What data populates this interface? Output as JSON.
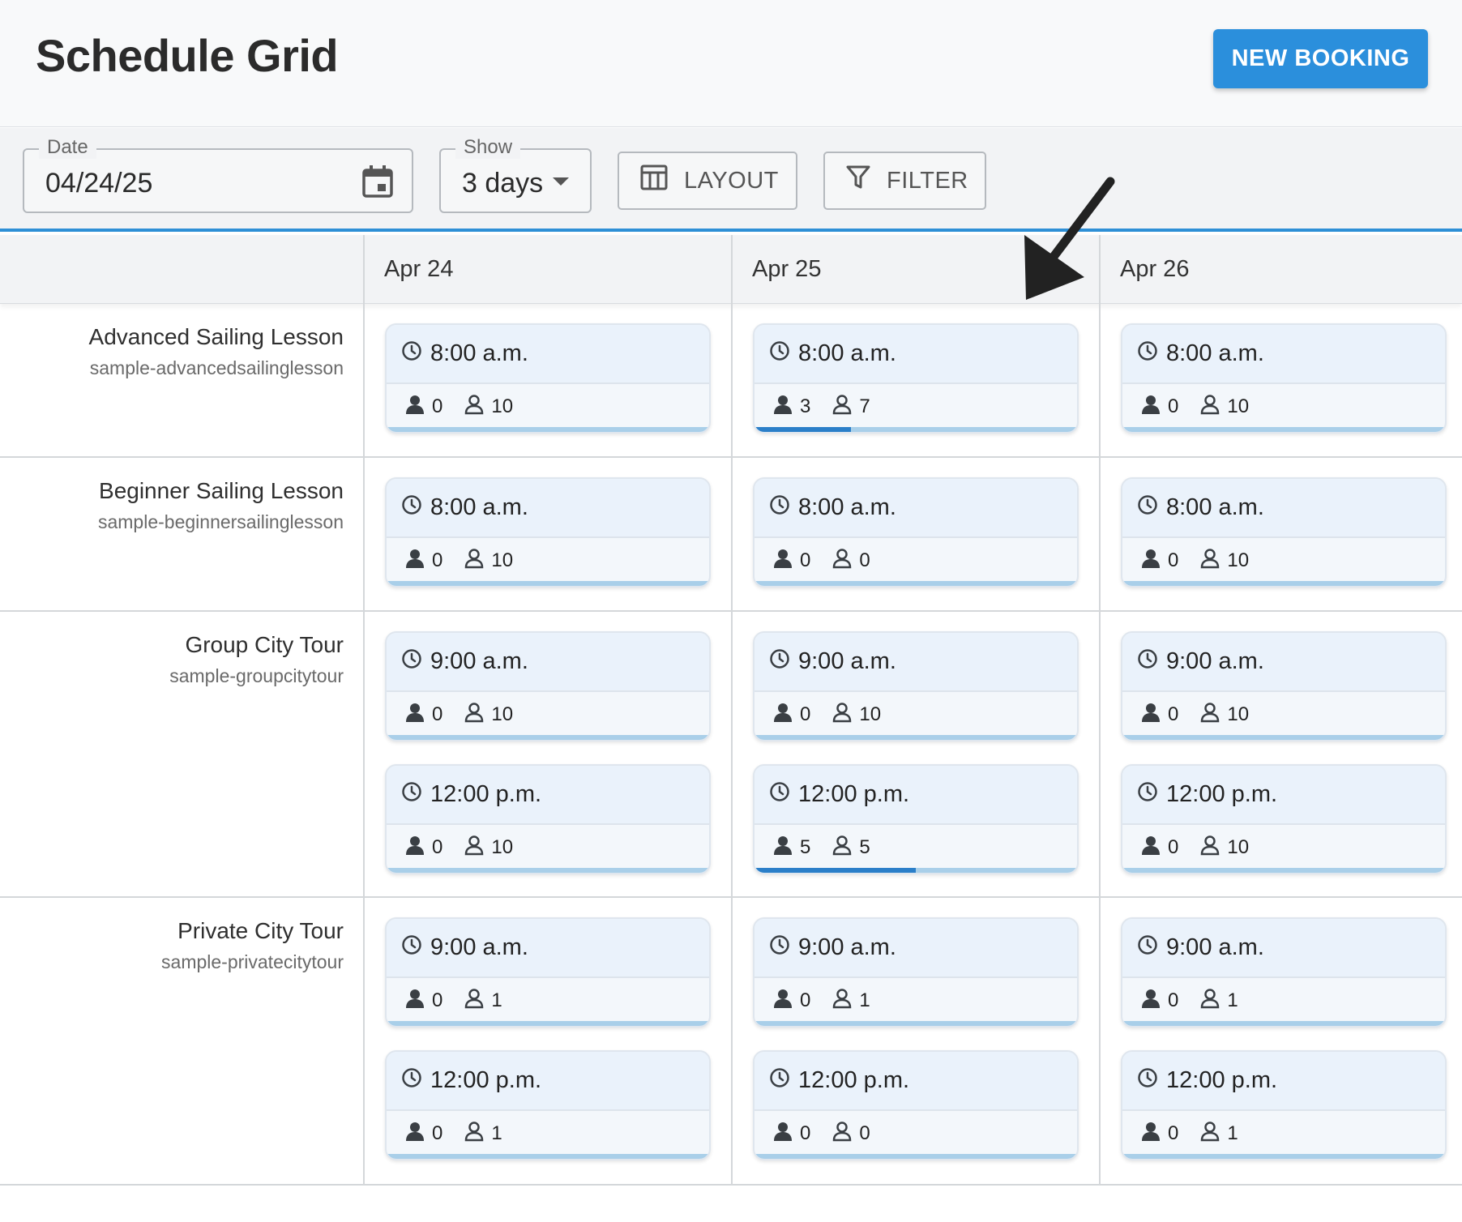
{
  "header": {
    "title": "Schedule Grid",
    "new_booking_label": "NEW BOOKING"
  },
  "toolbar": {
    "date_label": "Date",
    "date_value": "04/24/25",
    "show_label": "Show",
    "show_value": "3 days",
    "layout_label": "LAYOUT",
    "filter_label": "FILTER"
  },
  "days": [
    "Apr 24",
    "Apr 25",
    "Apr 26"
  ],
  "products": [
    {
      "name": "Advanced Sailing Lesson",
      "slug": "sample-advancedsailinglesson"
    },
    {
      "name": "Beginner Sailing Lesson",
      "slug": "sample-beginnersailinglesson"
    },
    {
      "name": "Group City Tour",
      "slug": "sample-groupcitytour"
    },
    {
      "name": "Private City Tour",
      "slug": "sample-privatecitytour"
    }
  ],
  "slots": [
    [
      [
        {
          "time": "8:00 a.m.",
          "booked": "0",
          "available": "10",
          "fill": 0
        }
      ],
      [
        {
          "time": "8:00 a.m.",
          "booked": "3",
          "available": "7",
          "fill": 0.3
        }
      ],
      [
        {
          "time": "8:00 a.m.",
          "booked": "0",
          "available": "10",
          "fill": 0
        }
      ]
    ],
    [
      [
        {
          "time": "8:00 a.m.",
          "booked": "0",
          "available": "10",
          "fill": 0
        }
      ],
      [
        {
          "time": "8:00 a.m.",
          "booked": "0",
          "available": "0",
          "fill": 0
        }
      ],
      [
        {
          "time": "8:00 a.m.",
          "booked": "0",
          "available": "10",
          "fill": 0
        }
      ]
    ],
    [
      [
        {
          "time": "9:00 a.m.",
          "booked": "0",
          "available": "10",
          "fill": 0
        },
        {
          "time": "12:00 p.m.",
          "booked": "0",
          "available": "10",
          "fill": 0
        }
      ],
      [
        {
          "time": "9:00 a.m.",
          "booked": "0",
          "available": "10",
          "fill": 0
        },
        {
          "time": "12:00 p.m.",
          "booked": "5",
          "available": "5",
          "fill": 0.5
        }
      ],
      [
        {
          "time": "9:00 a.m.",
          "booked": "0",
          "available": "10",
          "fill": 0
        },
        {
          "time": "12:00 p.m.",
          "booked": "0",
          "available": "10",
          "fill": 0
        }
      ]
    ],
    [
      [
        {
          "time": "9:00 a.m.",
          "booked": "0",
          "available": "1",
          "fill": 0
        },
        {
          "time": "12:00 p.m.",
          "booked": "0",
          "available": "1",
          "fill": 0
        }
      ],
      [
        {
          "time": "9:00 a.m.",
          "booked": "0",
          "available": "1",
          "fill": 0
        },
        {
          "time": "12:00 p.m.",
          "booked": "0",
          "available": "0",
          "fill": 0
        }
      ],
      [
        {
          "time": "9:00 a.m.",
          "booked": "0",
          "available": "1",
          "fill": 0
        },
        {
          "time": "12:00 p.m.",
          "booked": "0",
          "available": "1",
          "fill": 0
        }
      ]
    ]
  ],
  "colors": {
    "accent": "#2b8fdc",
    "progress": "#2b7fc9",
    "progress_track": "#a9cfe9"
  }
}
